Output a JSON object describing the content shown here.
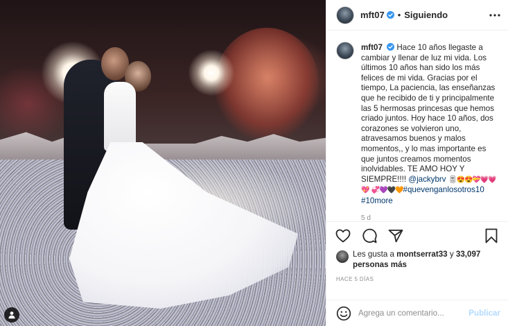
{
  "post": {
    "photo_alt": "",
    "user_tag_icon": "user-icon"
  },
  "header": {
    "username": "mft07",
    "separator": "•",
    "follow_label": "Siguiendo",
    "more_icon": "more-horizontal-icon",
    "verified_icon": "verified-badge-icon"
  },
  "caption": {
    "username": "mft07",
    "text": "Hace 10 años llegaste a cambiar y llenar de luz mi vida. Los últimos 10 años han sido los más felices de mi vida. Gracias por el tiempo, La paciencia, las enseñanzas que he recibido de ti y principalmente las 5 hermosas princesas que hemos criado juntos. Hoy hace 10 años, dos corazones se volvieron uno, atravesamos buenos y malos momentos,, y lo mas importante es que juntos creamos momentos inolvidables. TE AMO HOY Y SIEMPRE!!!! ",
    "mention": "@jackybrv",
    "emojis_1": "🎚😍😍💝💗💗💖",
    "emojis_2": "💞💜🖤🧡",
    "hashtag_1": "#quevenganlosotros10",
    "hashtag_2": "#10more",
    "time_ago": "5 d"
  },
  "actions": {
    "like_icon": "heart-icon",
    "comment_icon": "comment-icon",
    "share_icon": "paper-plane-icon",
    "save_icon": "bookmark-icon"
  },
  "likes": {
    "prefix": "Les gusta a ",
    "user": "montserrat33",
    "middle": " y ",
    "count": "33,097 personas más"
  },
  "date": "Hace 5 días",
  "add_comment": {
    "smile_icon": "emoji-icon",
    "placeholder": "Agrega un comentario...",
    "publish_label": "Publicar"
  },
  "colors": {
    "link": "#00376b",
    "verified": "#3897f0",
    "publish_disabled": "#b3dbff",
    "muted": "#8e8e8e"
  }
}
